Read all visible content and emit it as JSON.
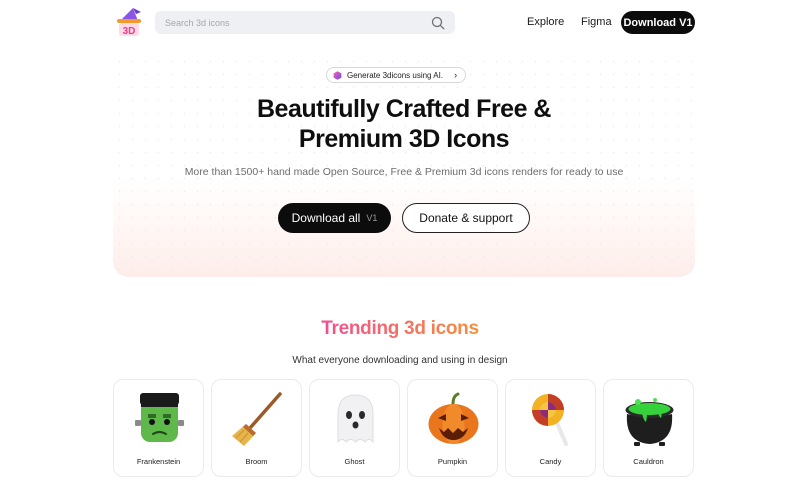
{
  "header": {
    "logo_icon": "3d-witch-hat-logo-icon",
    "search_placeholder": "Search 3d icons",
    "nav": {
      "explore": "Explore",
      "figma": "Figma",
      "download": "Download V1"
    }
  },
  "hero": {
    "pill_text": "Generate 3dicons using AI.",
    "title_line1": "Beautifully Crafted Free &",
    "title_line2": "Premium 3D Icons",
    "subtitle": "More than 1500+ hand made Open Source, Free & Premium 3d icons renders for ready to use",
    "download_label": "Download all",
    "download_tag": "V1",
    "donate_label": "Donate & support"
  },
  "trending": {
    "title": "Trending 3d icons",
    "subtitle": "What everyone downloading and using in design",
    "items": [
      {
        "label": "Frankenstein",
        "icon": "frankenstein-icon"
      },
      {
        "label": "Broom",
        "icon": "broom-icon"
      },
      {
        "label": "Ghost",
        "icon": "ghost-icon"
      },
      {
        "label": "Pumpkin",
        "icon": "pumpkin-icon"
      },
      {
        "label": "Candy",
        "icon": "candy-icon"
      },
      {
        "label": "Cauldron",
        "icon": "cauldron-icon"
      }
    ]
  },
  "colors": {
    "accent_dark": "#0c0c0c",
    "gradient_pink": "#f03ea6",
    "gradient_orange": "#f7a027"
  }
}
